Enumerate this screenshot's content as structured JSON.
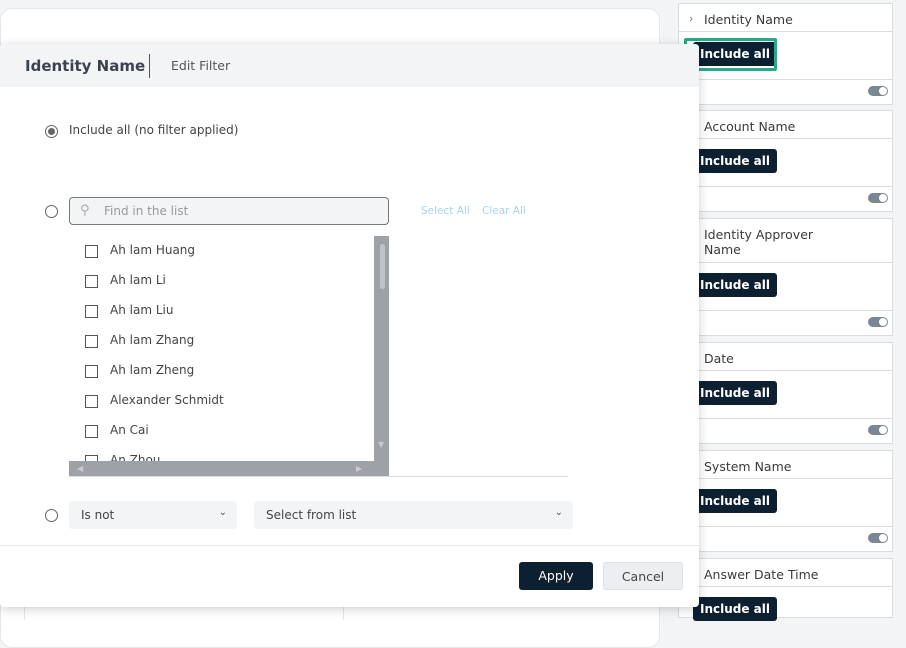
{
  "modal": {
    "title": "Identity Name",
    "subtitle": "Edit Filter",
    "option_include_all": "Include all (no filter applied)",
    "search_placeholder": "Find in the list",
    "select_all": "Select All",
    "clear_all": "Clear All",
    "items": [
      {
        "label": "Ah lam Huang"
      },
      {
        "label": "Ah lam Li"
      },
      {
        "label": "Ah lam Liu"
      },
      {
        "label": "Ah lam Zhang"
      },
      {
        "label": "Ah lam Zheng"
      },
      {
        "label": "Alexander Schmidt"
      },
      {
        "label": "An Cai"
      },
      {
        "label": "An Zhou"
      }
    ],
    "operator_select": "Is not",
    "value_select": "Select from list",
    "apply_label": "Apply",
    "cancel_label": "Cancel"
  },
  "filters": [
    {
      "name": "Identity Name",
      "value": "Include all"
    },
    {
      "name": "Account Name",
      "value": "Include all"
    },
    {
      "name": "Identity Approver Name",
      "value": "Include all"
    },
    {
      "name": "Date",
      "value": "Include all"
    },
    {
      "name": "System Name",
      "value": "Include all"
    },
    {
      "name": "Answer Date Time",
      "value": "Include all"
    }
  ],
  "colors": {
    "accent_dark": "#0d2031",
    "highlight": "#2aa889",
    "link": "#a9d2ee"
  }
}
